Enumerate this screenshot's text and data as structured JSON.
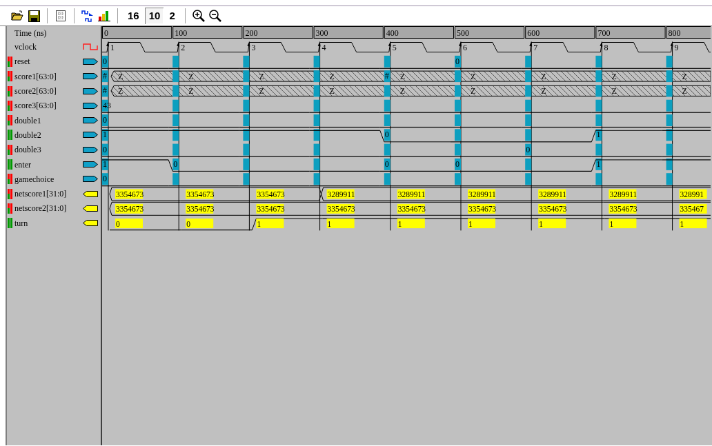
{
  "toolbar": {
    "radix_buttons": [
      {
        "label": "16",
        "selected": false
      },
      {
        "label": "10",
        "selected": true
      },
      {
        "label": "2",
        "selected": false
      }
    ]
  },
  "time_label": "Time (ns)",
  "ruler": [
    "0",
    "100",
    "200",
    "300",
    "400",
    "500",
    "600",
    "700",
    "800"
  ],
  "signals": [
    {
      "name": "vclock",
      "kind": "clock",
      "cycles": [
        {
          "value": "1"
        },
        {
          "value": "2"
        },
        {
          "value": "3"
        },
        {
          "value": "4"
        },
        {
          "value": "5"
        },
        {
          "value": "6"
        },
        {
          "value": "7"
        },
        {
          "value": "8"
        },
        {
          "value": "9"
        }
      ]
    },
    {
      "name": "reset",
      "kind": "input_bit",
      "color": "#ff0000",
      "cycles": [
        {
          "high": false,
          "mark": "0"
        },
        {
          "high": false
        },
        {
          "high": false
        },
        {
          "high": false
        },
        {
          "high": false
        },
        {
          "high": false,
          "mark": "0"
        },
        {
          "high": false
        },
        {
          "high": false
        },
        {
          "high": false
        }
      ]
    },
    {
      "name": "score1[63:0]",
      "kind": "input_z",
      "color": "#ff0000",
      "cycles": [
        {
          "mark": "#",
          "value": "Z"
        },
        {
          "value": "Z"
        },
        {
          "value": "Z"
        },
        {
          "value": "Z"
        },
        {
          "mark": "#",
          "value": "Z"
        },
        {
          "value": "Z"
        },
        {
          "value": "Z"
        },
        {
          "value": "Z"
        },
        {
          "value": "Z"
        }
      ]
    },
    {
      "name": "score2[63:0]",
      "kind": "input_z",
      "color": "#ff0000",
      "cycles": [
        {
          "mark": "#",
          "value": "Z"
        },
        {
          "value": "Z"
        },
        {
          "value": "Z"
        },
        {
          "value": "Z"
        },
        {
          "value": "Z"
        },
        {
          "value": "Z"
        },
        {
          "value": "Z"
        },
        {
          "value": "Z"
        },
        {
          "value": "Z"
        }
      ]
    },
    {
      "name": "score3[63:0]",
      "kind": "input_bit",
      "color": "#ff0000",
      "cycles": [
        {
          "high": false,
          "mark": "43"
        },
        {
          "high": false
        },
        {
          "high": false
        },
        {
          "high": false
        },
        {
          "high": false
        },
        {
          "high": false
        },
        {
          "high": false
        },
        {
          "high": false
        },
        {
          "high": false
        }
      ]
    },
    {
      "name": "double1",
      "kind": "input_bit",
      "color": "#ff0000",
      "cycles": [
        {
          "high": false,
          "mark": "0"
        },
        {
          "high": false
        },
        {
          "high": false
        },
        {
          "high": false
        },
        {
          "high": false
        },
        {
          "high": false
        },
        {
          "high": false
        },
        {
          "high": false
        },
        {
          "high": false
        }
      ]
    },
    {
      "name": "double2",
      "kind": "input_bit",
      "color": "#009900",
      "cycles": [
        {
          "high": true,
          "mark": "1"
        },
        {
          "high": true
        },
        {
          "high": true
        },
        {
          "high": true
        },
        {
          "high": false,
          "mark": "0"
        },
        {
          "high": false
        },
        {
          "high": false
        },
        {
          "high": true,
          "mark": "1"
        },
        {
          "high": true
        }
      ]
    },
    {
      "name": "double3",
      "kind": "input_bit",
      "color": "#ff0000",
      "cycles": [
        {
          "high": false,
          "mark": "0"
        },
        {
          "high": false
        },
        {
          "high": false
        },
        {
          "high": false
        },
        {
          "high": false
        },
        {
          "high": false
        },
        {
          "high": false,
          "mark": "0"
        },
        {
          "high": false
        },
        {
          "high": false
        }
      ]
    },
    {
      "name": "enter",
      "kind": "input_bit",
      "color": "#009900",
      "cycles": [
        {
          "high": true,
          "mark": "1"
        },
        {
          "high": false,
          "mark": "0"
        },
        {
          "high": false
        },
        {
          "high": false
        },
        {
          "high": false,
          "mark": "0"
        },
        {
          "high": false,
          "mark": "0"
        },
        {
          "high": false
        },
        {
          "high": true,
          "mark": "1"
        },
        {
          "high": true
        }
      ]
    },
    {
      "name": "gamechoice",
      "kind": "input_bit",
      "color": "#ff0000",
      "cycles": [
        {
          "high": false,
          "mark": "0"
        },
        {
          "high": false
        },
        {
          "high": false
        },
        {
          "high": false
        },
        {
          "high": false
        },
        {
          "high": false
        },
        {
          "high": false
        },
        {
          "high": false
        },
        {
          "high": false
        }
      ]
    },
    {
      "name": "netscore1[31:0]",
      "kind": "output_bus",
      "color": "#ff0000",
      "cycles": [
        {
          "change": true,
          "value": "3354673"
        },
        {
          "change": false,
          "value": "3354673"
        },
        {
          "change": false,
          "value": "3354673"
        },
        {
          "change": true,
          "value": "3289911"
        },
        {
          "change": false,
          "value": "3289911"
        },
        {
          "change": false,
          "value": "3289911"
        },
        {
          "change": false,
          "value": "3289911"
        },
        {
          "change": false,
          "value": "3289911"
        },
        {
          "change": false,
          "value": "328991"
        }
      ]
    },
    {
      "name": "netscore2[31:0]",
      "kind": "output_bus",
      "color": "#ff0000",
      "cycles": [
        {
          "change": true,
          "value": "3354673"
        },
        {
          "change": false,
          "value": "3354673"
        },
        {
          "change": false,
          "value": "3354673"
        },
        {
          "change": false,
          "value": "3354673"
        },
        {
          "change": false,
          "value": "3354673"
        },
        {
          "change": false,
          "value": "3354673"
        },
        {
          "change": false,
          "value": "3354673"
        },
        {
          "change": false,
          "value": "3354673"
        },
        {
          "change": false,
          "value": "335467"
        }
      ]
    },
    {
      "name": "turn",
      "kind": "output_bit",
      "color": "#009900",
      "cycles": [
        {
          "high": false,
          "value": "0"
        },
        {
          "high": false,
          "value": "0"
        },
        {
          "high": true,
          "value": "1"
        },
        {
          "high": true,
          "value": "1"
        },
        {
          "high": true,
          "value": "1"
        },
        {
          "high": true,
          "value": "1"
        },
        {
          "high": true,
          "value": "1"
        },
        {
          "high": true,
          "value": "1"
        },
        {
          "high": true,
          "value": "1"
        }
      ]
    }
  ]
}
